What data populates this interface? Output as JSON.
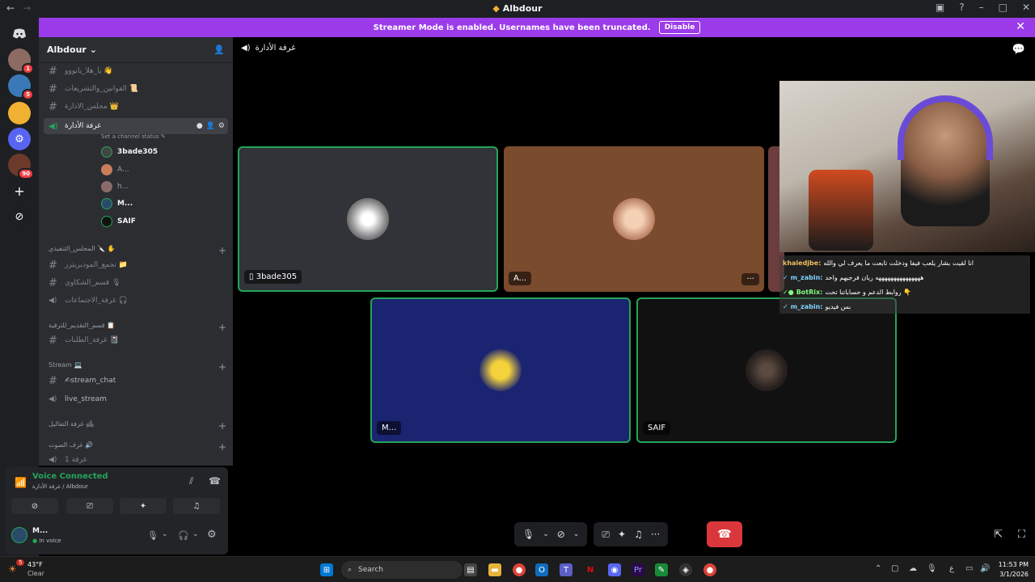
{
  "window": {
    "title": "Albdour",
    "back": "←",
    "forward": "→"
  },
  "banner": {
    "text": "Streamer Mode is enabled. Usernames have been truncated.",
    "disable_label": "Disable"
  },
  "server_badges": {
    "s1": "1",
    "s3": "5",
    "s6": "90"
  },
  "server": {
    "name": "Albdour"
  },
  "channels": [
    {
      "name": "يا_هلا_يابووو 👋",
      "type": "text"
    },
    {
      "name": "القوانين_والتشريعات 📜",
      "type": "text"
    },
    {
      "name": "مجلس_الادارة 👑",
      "type": "text"
    },
    {
      "name": "غرفة الأدارة",
      "type": "voice",
      "status": "Set a channel status"
    }
  ],
  "voice_users": [
    "3bade305",
    "A...",
    "h...",
    "M...",
    "SAIF"
  ],
  "categories": [
    {
      "name": "المجلس_التنفيذي 🔪 ✋",
      "channels": [
        {
          "name": "تجمع_الموديريترز 📁",
          "type": "text"
        },
        {
          "name": "قسم_الشكاوي 🎙",
          "type": "text"
        },
        {
          "name": "غرفة_الاجتماعات 🎧",
          "type": "voice"
        }
      ]
    },
    {
      "name": "قسم_التقديم_للترقية 📋",
      "channels": [
        {
          "name": "غرفة_الطلبات 📓",
          "type": "text"
        }
      ]
    },
    {
      "name": "Stream 💻",
      "channels": [
        {
          "name": "✍stream_chat",
          "type": "text"
        },
        {
          "name": "live_stream",
          "type": "voice"
        }
      ]
    },
    {
      "name": "غرفة التفاليل 🛋",
      "channels": []
    },
    {
      "name": "غرف الصوت 🔊",
      "channels": [
        {
          "name": "غرفة 1",
          "type": "voice"
        }
      ]
    }
  ],
  "voice_panel": {
    "title": "Voice Connected",
    "subtitle": "غرفة الأدارة / Albdour"
  },
  "me": {
    "name": "M...",
    "status": "In voice"
  },
  "stage": {
    "channel_title": "غرفة الأدارة"
  },
  "tiles": [
    {
      "label": "3bade305"
    },
    {
      "label": "A...",
      "more": "···"
    },
    {
      "label": "M..."
    },
    {
      "label": "SAIF"
    }
  ],
  "chat_overlay": [
    {
      "name": "khaledjbe:",
      "text": "انا لقيت بشار يلعب فيفا ودخلت تابعت ما يعرف لي والله",
      "color": "#f0c060"
    },
    {
      "name": "m_zabin:",
      "text": "هههههههههههههههه ريان فرجيهم واحد",
      "color": "#7fd4ff"
    },
    {
      "name": "BotRix:",
      "text": "روابط الدعم و حساباتنا تحت 👇",
      "color": "#7fff7f"
    },
    {
      "name": "m_zabin:",
      "text": "بس فيديو",
      "color": "#7fd4ff"
    }
  ],
  "taskbar": {
    "weather_temp": "43°F",
    "weather_desc": "Clear",
    "weather_badge": "5",
    "search_placeholder": "Search",
    "time": "11:53 PM",
    "date": "3/1/2026",
    "lang": "ع"
  },
  "colors": {
    "accent": "#9b3bea",
    "speaking": "#23a55a",
    "hangup": "#da373c"
  }
}
